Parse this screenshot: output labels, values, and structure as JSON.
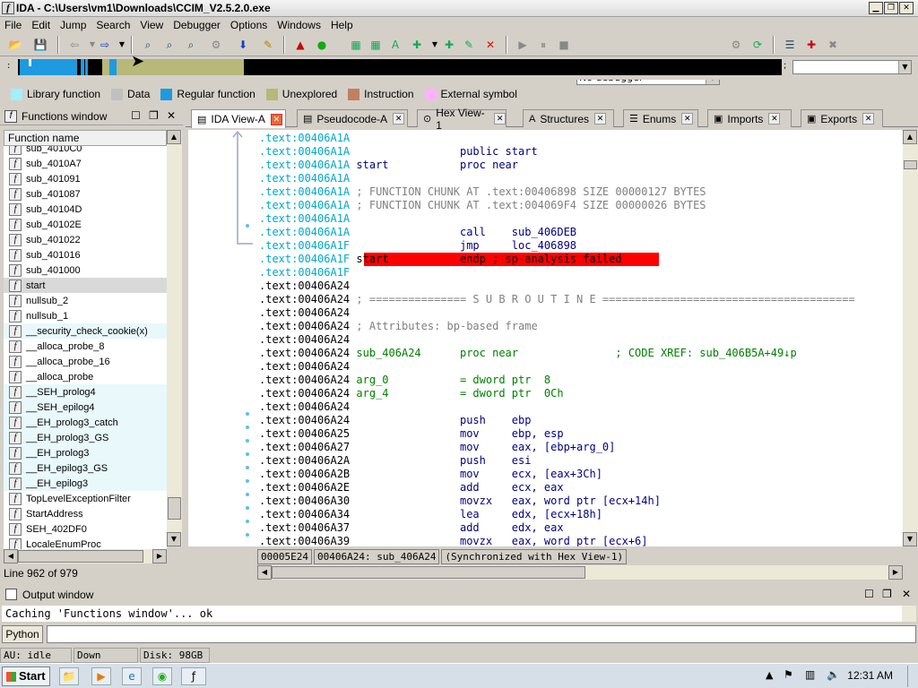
{
  "window": {
    "title": "IDA - C:\\Users\\vm1\\Downloads\\CCIM_V2.5.2.0.exe",
    "controls": [
      "minimize-icon",
      "restore-icon",
      "close-icon"
    ]
  },
  "menu": [
    "File",
    "Edit",
    "Jump",
    "Search",
    "View",
    "Debugger",
    "Options",
    "Windows",
    "Help"
  ],
  "toolbar": {
    "debugger_select": "No debugger"
  },
  "legend": [
    {
      "label": "Library function",
      "color": "#a0f0ff"
    },
    {
      "label": "Data",
      "color": "#c0c0c0"
    },
    {
      "label": "Regular function",
      "color": "#1e9ae0"
    },
    {
      "label": "Unexplored",
      "color": "#b8b878"
    },
    {
      "label": "Instruction",
      "color": "#c08060"
    },
    {
      "label": "External symbol",
      "color": "#ffb0ff"
    }
  ],
  "functions_window": {
    "title": "Functions window",
    "column": "Function name",
    "items": [
      {
        "name": "sub_4010C0",
        "type": "normal"
      },
      {
        "name": "sub_4010A7",
        "type": "normal"
      },
      {
        "name": "sub_401091",
        "type": "normal"
      },
      {
        "name": "sub_401087",
        "type": "normal"
      },
      {
        "name": "sub_40104D",
        "type": "normal"
      },
      {
        "name": "sub_40102E",
        "type": "normal"
      },
      {
        "name": "sub_401022",
        "type": "normal"
      },
      {
        "name": "sub_401016",
        "type": "normal"
      },
      {
        "name": "sub_401000",
        "type": "normal"
      },
      {
        "name": "start",
        "type": "selected"
      },
      {
        "name": "nullsub_2",
        "type": "normal"
      },
      {
        "name": "nullsub_1",
        "type": "normal"
      },
      {
        "name": "__security_check_cookie(x)",
        "type": "lib"
      },
      {
        "name": "__alloca_probe_8",
        "type": "normal"
      },
      {
        "name": "__alloca_probe_16",
        "type": "normal"
      },
      {
        "name": "__alloca_probe",
        "type": "normal"
      },
      {
        "name": "__SEH_prolog4",
        "type": "lib"
      },
      {
        "name": "__SEH_epilog4",
        "type": "lib"
      },
      {
        "name": "__EH_prolog3_catch",
        "type": "lib"
      },
      {
        "name": "__EH_prolog3_GS",
        "type": "lib"
      },
      {
        "name": "__EH_prolog3",
        "type": "lib"
      },
      {
        "name": "__EH_epilog3_GS",
        "type": "lib"
      },
      {
        "name": "__EH_epilog3",
        "type": "lib"
      },
      {
        "name": "TopLevelExceptionFilter",
        "type": "normal"
      },
      {
        "name": "StartAddress",
        "type": "normal"
      },
      {
        "name": "SEH_402DF0",
        "type": "normal"
      },
      {
        "name": "LocaleEnumProc",
        "type": "normal"
      }
    ],
    "status": "Line 962 of 979"
  },
  "tabs": [
    {
      "label": "IDA View-A",
      "active": true
    },
    {
      "label": "Pseudocode-A"
    },
    {
      "label": "Hex View-1"
    },
    {
      "label": "Structures"
    },
    {
      "label": "Enums"
    },
    {
      "label": "Imports"
    },
    {
      "label": "Exports"
    }
  ],
  "disasm": [
    {
      "addr": ".text:00406A1A",
      "cyan": true,
      "text": ""
    },
    {
      "addr": ".text:00406A1A",
      "cyan": true,
      "text": "                public start"
    },
    {
      "addr": ".text:00406A1A",
      "cyan": true,
      "text": "start           proc near"
    },
    {
      "addr": ".text:00406A1A",
      "cyan": true,
      "text": ""
    },
    {
      "addr": ".text:00406A1A",
      "cyan": true,
      "text": "; FUNCTION CHUNK AT .text:00406898 SIZE 00000127 BYTES",
      "comment": true
    },
    {
      "addr": ".text:00406A1A",
      "cyan": true,
      "text": "; FUNCTION CHUNK AT .text:004069F4 SIZE 00000026 BYTES",
      "comment": true
    },
    {
      "addr": ".text:00406A1A",
      "cyan": true,
      "text": ""
    },
    {
      "addr": ".text:00406A1A",
      "cyan": true,
      "text": "                call    sub_406DEB"
    },
    {
      "addr": ".text:00406A1F",
      "cyan": true,
      "text": "                jmp     loc_406898"
    },
    {
      "addr": ".text:00406A1F",
      "cyan": true,
      "text": "start           endp ; sp-analysis failed",
      "red": true
    },
    {
      "addr": ".text:00406A1F",
      "cyan": true,
      "text": ""
    },
    {
      "addr": ".text:00406A24",
      "text": ""
    },
    {
      "addr": ".text:00406A24",
      "text": "; =============== S U B R O U T I N E =======================================",
      "comment": true
    },
    {
      "addr": ".text:00406A24",
      "text": ""
    },
    {
      "addr": ".text:00406A24",
      "text": "; Attributes: bp-based frame",
      "comment": true
    },
    {
      "addr": ".text:00406A24",
      "text": ""
    },
    {
      "addr": ".text:00406A24",
      "text": "sub_406A24      proc near               ; CODE XREF: sub_406B5A+49↓p"
    },
    {
      "addr": ".text:00406A24",
      "text": ""
    },
    {
      "addr": ".text:00406A24",
      "text": "arg_0           = dword ptr  8"
    },
    {
      "addr": ".text:00406A24",
      "text": "arg_4           = dword ptr  0Ch"
    },
    {
      "addr": ".text:00406A24",
      "text": ""
    },
    {
      "addr": ".text:00406A24",
      "text": "                push    ebp"
    },
    {
      "addr": ".text:00406A25",
      "text": "                mov     ebp, esp"
    },
    {
      "addr": ".text:00406A27",
      "text": "                mov     eax, [ebp+arg_0]"
    },
    {
      "addr": ".text:00406A2A",
      "text": "                push    esi"
    },
    {
      "addr": ".text:00406A2B",
      "text": "                mov     ecx, [eax+3Ch]"
    },
    {
      "addr": ".text:00406A2E",
      "text": "                add     ecx, eax"
    },
    {
      "addr": ".text:00406A30",
      "text": "                movzx   eax, word ptr [ecx+14h]"
    },
    {
      "addr": ".text:00406A34",
      "text": "                lea     edx, [ecx+18h]"
    },
    {
      "addr": ".text:00406A37",
      "text": "                add     edx, eax"
    },
    {
      "addr": ".text:00406A39",
      "text": "                movzx   eax, word ptr [ecx+6]"
    }
  ],
  "ida_status": [
    "00005E24",
    "00406A24: sub_406A24",
    "(Synchronized with Hex View-1)"
  ],
  "output": {
    "title": "Output window",
    "text": "Caching 'Functions window'... ok",
    "python_button": "Python"
  },
  "statusbar": [
    "AU:  idle",
    "Down",
    "Disk: 98GB"
  ],
  "taskbar": {
    "start": "Start",
    "clock": "12:31 AM"
  }
}
